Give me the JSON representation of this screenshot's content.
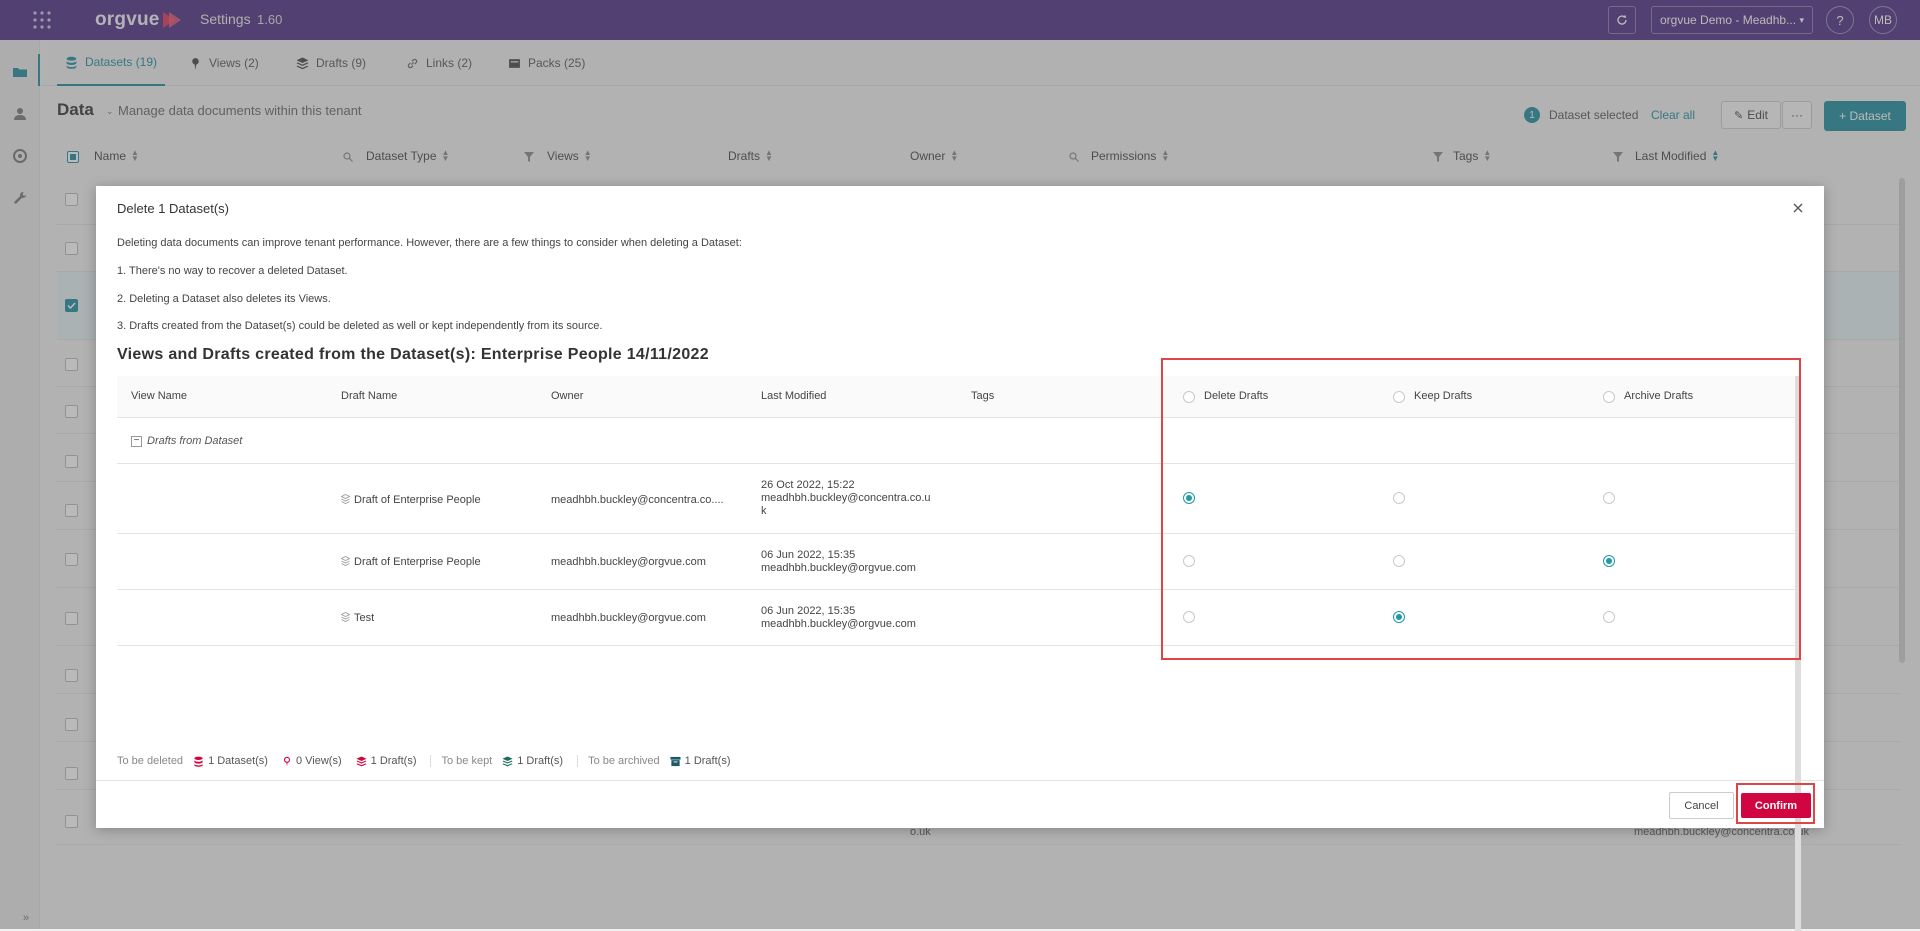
{
  "topbar": {
    "logo": "orgvue",
    "app_title": "Settings",
    "version": "1.60",
    "tenant": "orgvue Demo - Meadhb...",
    "help": "?",
    "user_initials": "MB"
  },
  "tabs": [
    {
      "label": "Datasets (19)",
      "icon": "database-icon"
    },
    {
      "label": "Views (2)",
      "icon": "pin-icon"
    },
    {
      "label": "Drafts (9)",
      "icon": "layers-icon"
    },
    {
      "label": "Links (2)",
      "icon": "link-icon"
    },
    {
      "label": "Packs (25)",
      "icon": "pack-icon"
    }
  ],
  "data_header": {
    "title": "Data",
    "description": "Manage data documents within this tenant",
    "selected_count": "1",
    "selected_label": "Dataset selected",
    "clear_all": "Clear all",
    "edit": "Edit",
    "more": "···",
    "add_dataset": "+ Dataset"
  },
  "bg_table": {
    "columns": [
      "Name",
      "Dataset Type",
      "Views",
      "Drafts",
      "Owner",
      "Permissions",
      "Tags",
      "Last Modified"
    ],
    "owner_cell_fragment": "o.uk",
    "last_modified_owner_fragment": "meadhbh.buckley@concentra.co.uk"
  },
  "modal": {
    "title": "Delete 1 Dataset(s)",
    "intro": "Deleting data documents can improve tenant performance. However, there are a few things to consider when deleting a Dataset:",
    "points": [
      "1. There's no way to recover a deleted Dataset.",
      "2. Deleting a Dataset also deletes its Views.",
      "3. Drafts created from the Dataset(s) could be deleted as well or kept independently from its source."
    ],
    "section_title": "Views and Drafts created from the Dataset(s): Enterprise People 14/11/2022",
    "columns": {
      "view_name": "View Name",
      "draft_name": "Draft Name",
      "owner": "Owner",
      "last_modified": "Last Modified",
      "tags": "Tags",
      "delete_drafts": "Delete Drafts",
      "keep_drafts": "Keep Drafts",
      "archive_drafts": "Archive Drafts"
    },
    "group_label": "Drafts from Dataset",
    "group_toggle": "−",
    "rows": [
      {
        "draft_name": "Draft of Enterprise People",
        "owner": "meadhbh.buckley@concentra.co....",
        "modified_date": "26 Oct 2022, 15:22",
        "modified_by": "meadhbh.buckley@concentra.co.u",
        "modified_by_wrap": "k",
        "choice": "delete"
      },
      {
        "draft_name": "Draft of Enterprise People",
        "owner": "meadhbh.buckley@orgvue.com",
        "modified_date": "06 Jun 2022, 15:35",
        "modified_by": "meadhbh.buckley@orgvue.com",
        "modified_by_wrap": "",
        "choice": "archive"
      },
      {
        "draft_name": "Test",
        "owner": "meadhbh.buckley@orgvue.com",
        "modified_date": "06 Jun 2022, 15:35",
        "modified_by": "meadhbh.buckley@orgvue.com",
        "modified_by_wrap": "",
        "choice": "keep"
      }
    ],
    "summary": {
      "to_be_deleted": "To be deleted",
      "deleted_datasets": "1 Dataset(s)",
      "deleted_views": "0 View(s)",
      "deleted_drafts": "1 Draft(s)",
      "to_be_kept": "To be kept",
      "kept_drafts": "1 Draft(s)",
      "to_be_archived": "To be archived",
      "archived_drafts": "1 Draft(s)"
    },
    "cancel": "Cancel",
    "confirm": "Confirm"
  },
  "colors": {
    "topbar": "#4b2d82",
    "accent": "#1e8c9e",
    "danger": "#d1053f",
    "highlight": "#e04545"
  }
}
